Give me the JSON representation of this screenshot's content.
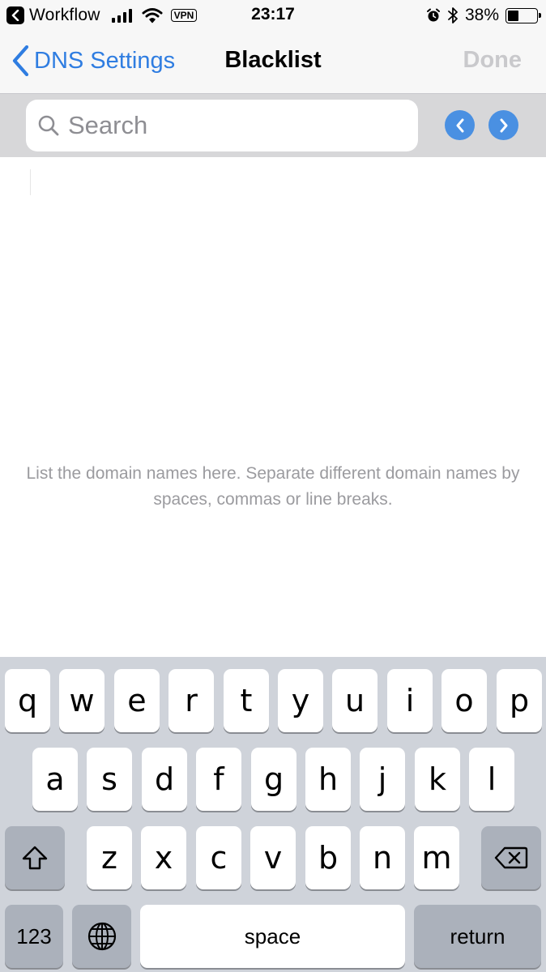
{
  "status_bar": {
    "back_app": "Workflow",
    "vpn": "VPN",
    "time": "23:17",
    "battery_pct": "38%",
    "battery_level": 0.38,
    "icons": [
      "back-app-icon",
      "signal-icon",
      "wifi-icon",
      "vpn-badge",
      "alarm-icon",
      "bluetooth-icon",
      "battery-icon"
    ]
  },
  "nav": {
    "back_label": "DNS Settings",
    "title": "Blacklist",
    "done_label": "Done"
  },
  "search": {
    "placeholder": "Search",
    "value": ""
  },
  "content": {
    "hint": "List the domain names here. Separate different domain names by spaces, commas or line breaks."
  },
  "keyboard": {
    "row1": [
      "q",
      "w",
      "e",
      "r",
      "t",
      "y",
      "u",
      "i",
      "o",
      "p"
    ],
    "row2": [
      "a",
      "s",
      "d",
      "f",
      "g",
      "h",
      "j",
      "k",
      "l"
    ],
    "row3": [
      "z",
      "x",
      "c",
      "v",
      "b",
      "n",
      "m"
    ],
    "numbers_label": "123",
    "space_label": "space",
    "return_label": "return"
  },
  "colors": {
    "accent": "#2f7de1",
    "arrow_button": "#4a90e2",
    "done_disabled": "#c9c9cc",
    "keyboard_bg": "#cfd3da",
    "hint_text": "#9b9b9f"
  }
}
